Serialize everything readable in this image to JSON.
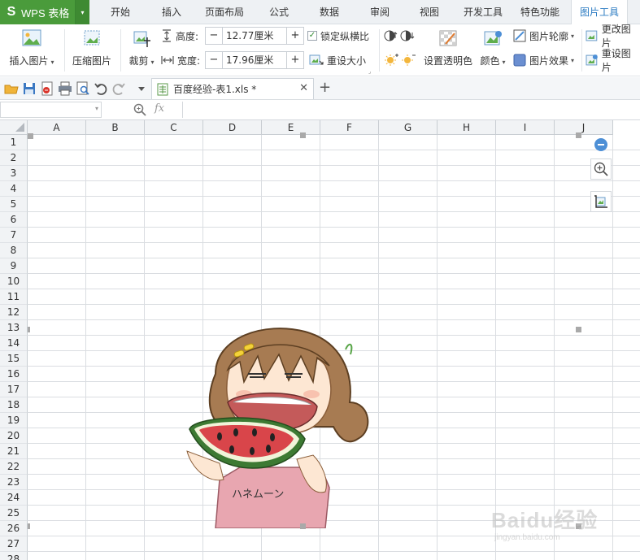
{
  "app": {
    "name": "WPS 表格"
  },
  "menu": {
    "tabs": [
      {
        "label": "开始"
      },
      {
        "label": "插入"
      },
      {
        "label": "页面布局"
      },
      {
        "label": "公式"
      },
      {
        "label": "数据"
      },
      {
        "label": "审阅"
      },
      {
        "label": "视图"
      },
      {
        "label": "开发工具"
      },
      {
        "label": "特色功能"
      },
      {
        "label": "图片工具"
      }
    ],
    "active": "图片工具"
  },
  "ribbon": {
    "insert_picture": "插入图片",
    "compress_picture": "压缩图片",
    "crop": "裁剪",
    "height_label": "高度:",
    "height_value": "12.77厘米",
    "width_label": "宽度:",
    "width_value": "17.96厘米",
    "lock_ratio": "锁定纵横比",
    "lock_ratio_checked": true,
    "reset_size": "重设大小",
    "set_transparent": "设置透明色",
    "color": "颜色",
    "picture_outline": "图片轮廓",
    "picture_effect": "图片效果",
    "change_picture": "更改图片",
    "reset_picture": "重设图片"
  },
  "document": {
    "tab_label": "百度经验-表1.xls *"
  },
  "formula_bar": {
    "name_box": "",
    "fx": "fx",
    "formula": ""
  },
  "sheet": {
    "columns": [
      "A",
      "B",
      "C",
      "D",
      "E",
      "F",
      "G",
      "H",
      "I",
      "J"
    ],
    "rows": [
      "1",
      "2",
      "3",
      "4",
      "5",
      "6",
      "7",
      "8",
      "9",
      "10",
      "11",
      "12",
      "13",
      "14",
      "15",
      "16",
      "17",
      "18",
      "19",
      "20",
      "21",
      "22",
      "23",
      "24",
      "25",
      "26",
      "27",
      "28"
    ]
  },
  "picture": {
    "shirt_text": "ハネムーン"
  },
  "watermark": {
    "text": "Baidu经验",
    "sub": "jingyan.baidu.com"
  },
  "colors": {
    "app_green": "#4a9b3b",
    "active_tab_text": "#2b7bc2",
    "grid_line": "#dadde1",
    "header_bg": "#f1f3f5"
  }
}
